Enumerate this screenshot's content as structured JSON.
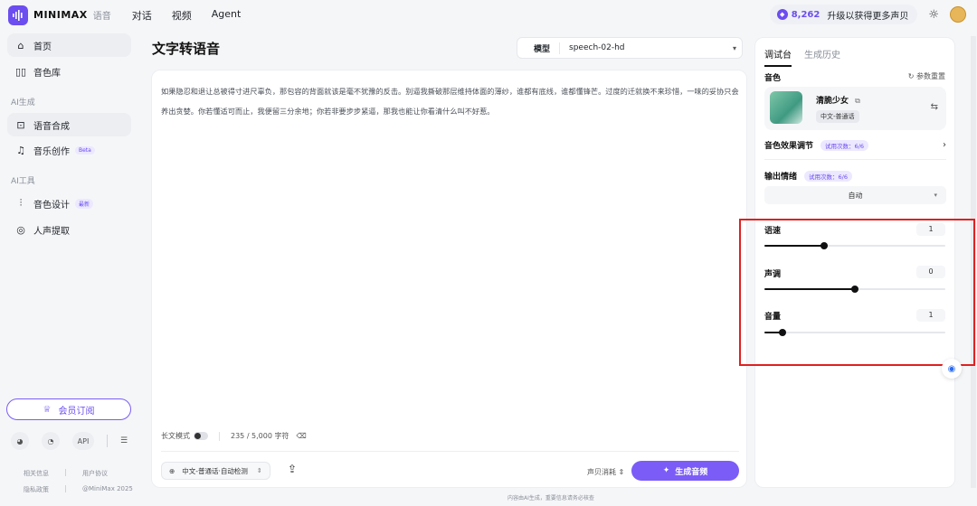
{
  "header": {
    "logo_icon": "waveform-icon",
    "brand": "MINIMAX",
    "brand_sub": "语音",
    "nav": [
      "对话",
      "视频",
      "Agent"
    ],
    "credits": "8,262",
    "upgrade": "升级以获得更多声贝"
  },
  "sidebar": {
    "home": "首页",
    "voice_library": "音色库",
    "section_ai_gen": "AI生成",
    "speech_synthesis": "语音合成",
    "music_creation": "音乐创作",
    "music_badge": "Beta",
    "section_ai_tools": "AI工具",
    "voice_design": "音色设计",
    "voice_design_badge": "最新",
    "vocal_extract": "人声提取",
    "vip": "会员订阅",
    "api": "API",
    "footer": [
      "相关信息",
      "用户协议",
      "隐私政策",
      "@MiniMax 2025"
    ]
  },
  "main": {
    "title": "文字转语音",
    "model_label": "模型",
    "model_value": "speech-02-hd",
    "text": "如果隐忍和退让总被得寸进尺辜负，那包容的背面就该是毫不犹豫的反击。别逼我撕破那层维持体面的薄纱，谁都有底线，谁都懂锋芒。过度的迁就换不来珍惜，一味的妥协只会养出贪婪。你若懂适可而止，我便留三分余地；你若非要步步紧逼，那我也能让你看清什么叫不好惹。",
    "long_mode": "长文模式",
    "char_count": "235 / 5,000 字符",
    "language": "中文-普通话·自动检测",
    "cost_label": "声贝消耗",
    "generate": "生成音频",
    "disclaimer": "内容由AI生成，重要信息请务必核查"
  },
  "panel": {
    "tab_debug": "调试台",
    "tab_history": "生成历史",
    "voice_label": "音色",
    "reset": "参数重置",
    "voice_name": "清脆少女",
    "voice_tag": "中文-普通话",
    "effect_label": "音色效果调节",
    "effect_trial": "试用次数：6/6",
    "emotion_label": "输出情绪",
    "emotion_trial": "试用次数：6/6",
    "emotion_value": "自动",
    "speed_label": "语速",
    "speed_value": "1",
    "speed_fraction": 0.33,
    "pitch_label": "声调",
    "pitch_value": "0",
    "pitch_fraction": 0.5,
    "volume_label": "音量",
    "volume_value": "1",
    "volume_fraction": 0.1
  },
  "colors": {
    "accent": "#7b5cf7",
    "highlight": "#e02020"
  }
}
